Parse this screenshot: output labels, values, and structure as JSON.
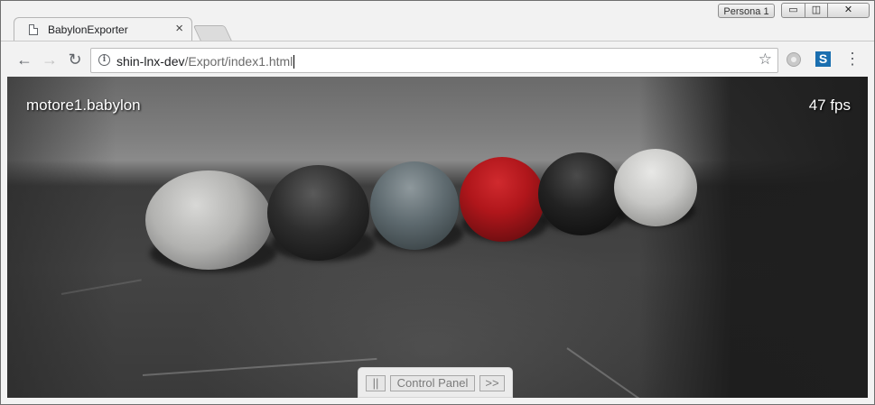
{
  "browser": {
    "tab_title": "BabylonExporter",
    "tab_close": "×",
    "profile_label": "Persona 1",
    "window_controls": {
      "minimize": "▭",
      "maximize": "◫",
      "close": "✕"
    },
    "nav": {
      "back_icon": "arrow-left-icon",
      "forward_icon": "arrow-right-icon",
      "reload_icon": "reload-icon",
      "back": "←",
      "forward": "→",
      "reload": "↻"
    },
    "address": {
      "host": "shin-lnx-dev",
      "path": "/Export/index1.html"
    },
    "bookmark_star": "☆",
    "menu_glyph": "⋮",
    "extension_2_glyph": "S"
  },
  "scene": {
    "title": "motore1.babylon",
    "fps": "47 fps",
    "spheres": [
      "stone",
      "dark-metal",
      "blue-grey",
      "red",
      "black",
      "white"
    ]
  },
  "control_panel": {
    "pause_label": "||",
    "label": "Control Panel",
    "expand_label": ">>"
  },
  "colors": {
    "chrome_bg": "#f2f2f2",
    "red_sphere": "#b0161b",
    "overlay_text": "#ffffff"
  }
}
